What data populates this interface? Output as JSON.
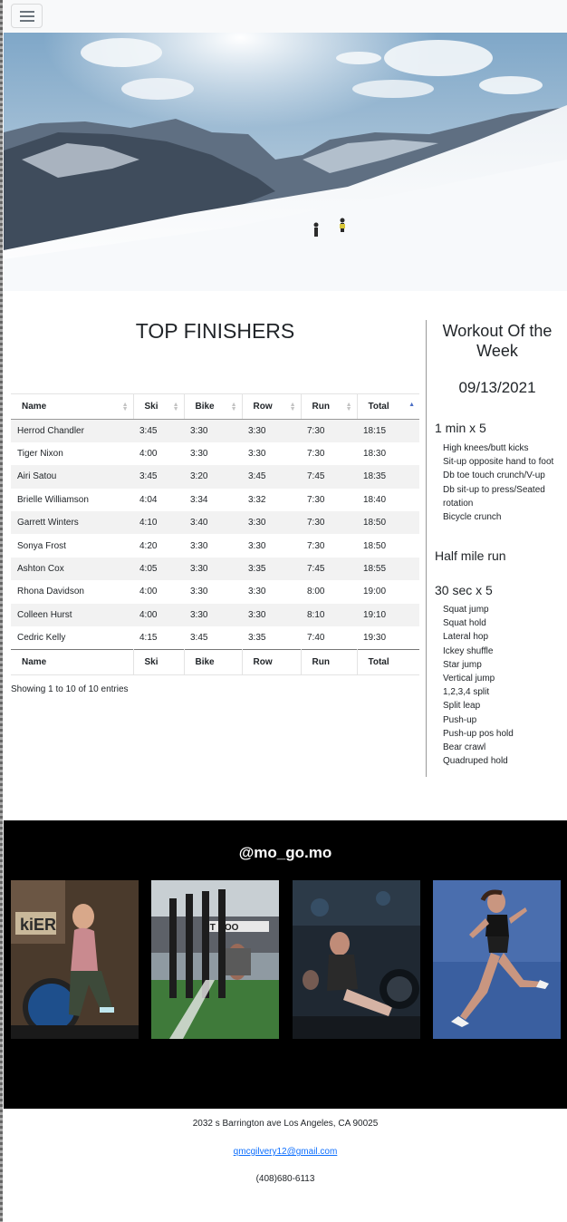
{
  "navbar": {
    "toggler_icon": "hamburger-menu-icon"
  },
  "hero": {
    "image": "mountain-skiers-photo"
  },
  "leaderboard": {
    "title": "TOP FINISHERS",
    "columns": [
      "Name",
      "Ski",
      "Bike",
      "Row",
      "Run",
      "Total"
    ],
    "sorted_column": "Total",
    "rows": [
      [
        "Herrod Chandler",
        "3:45",
        "3:30",
        "3:30",
        "7:30",
        "18:15"
      ],
      [
        "Tiger Nixon",
        "4:00",
        "3:30",
        "3:30",
        "7:30",
        "18:30"
      ],
      [
        "Airi Satou",
        "3:45",
        "3:20",
        "3:45",
        "7:45",
        "18:35"
      ],
      [
        "Brielle Williamson",
        "4:04",
        "3:34",
        "3:32",
        "7:30",
        "18:40"
      ],
      [
        "Garrett Winters",
        "4:10",
        "3:40",
        "3:30",
        "7:30",
        "18:50"
      ],
      [
        "Sonya Frost",
        "4:20",
        "3:30",
        "3:30",
        "7:30",
        "18:50"
      ],
      [
        "Ashton Cox",
        "4:05",
        "3:30",
        "3:35",
        "7:45",
        "18:55"
      ],
      [
        "Rhona Davidson",
        "4:00",
        "3:30",
        "3:30",
        "8:00",
        "19:00"
      ],
      [
        "Colleen Hurst",
        "4:00",
        "3:30",
        "3:30",
        "8:10",
        "19:10"
      ],
      [
        "Cedric Kelly",
        "4:15",
        "3:45",
        "3:35",
        "7:40",
        "19:30"
      ]
    ],
    "info": "Showing 1 to 10 of 10 entries"
  },
  "workout": {
    "title": "Workout Of the Week",
    "date": "09/13/2021",
    "section1_heading": "1 min x 5",
    "section1_items": [
      "High knees/butt kicks",
      "Sit-up opposite hand to foot",
      "Db toe touch crunch/V-up",
      "Db sit-up to press/Seated rotation",
      "Bicycle crunch"
    ],
    "section2_heading": "Half mile run",
    "section3_heading": "30 sec x 5",
    "section3_items": [
      "Squat jump",
      "Squat hold",
      "Lateral hop",
      "Ickey shuffle",
      "Star jump",
      "Vertical jump",
      "1,2,3,4 split",
      "Split leap",
      "Push-up",
      "Push-up pos hold",
      "Bear crawl",
      "Quadruped hold"
    ]
  },
  "instagram": {
    "handle": "@mo_go.mo",
    "photos": [
      "assault-bike-athlete-photo",
      "ski-erg-row-photo",
      "rowing-class-photo",
      "sprinting-runner-photo"
    ]
  },
  "footer": {
    "address": "2032 s Barrington ave Los Angeles, CA 90025",
    "email": "qmcgilvery12@gmail.com",
    "phone": "(408)680-6113"
  },
  "colors": {
    "link": "#0d6efd",
    "instagram_bg": "#000000",
    "navbar_bg": "#f8f9fa"
  }
}
